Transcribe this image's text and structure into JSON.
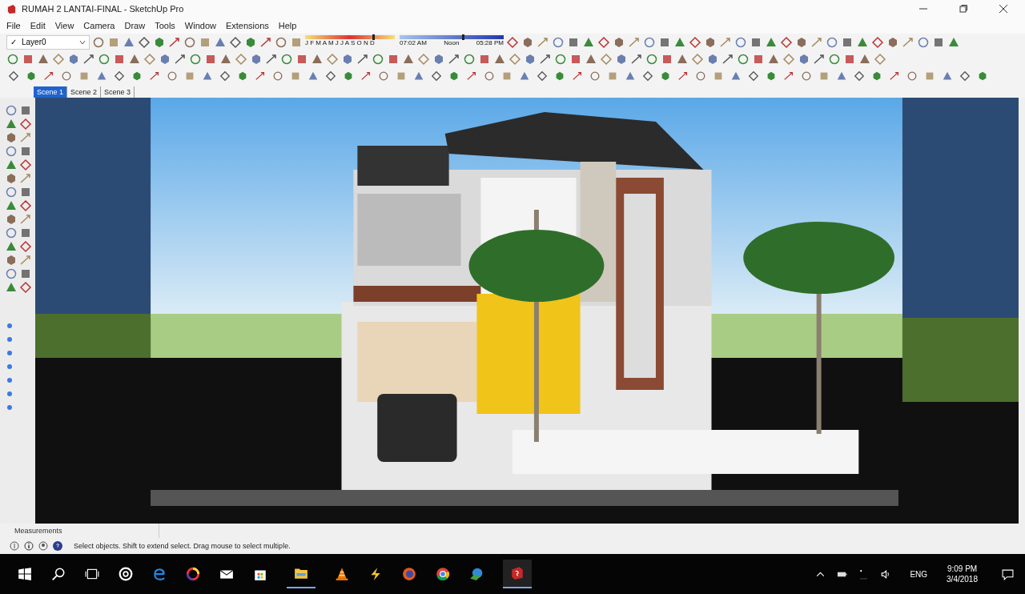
{
  "window": {
    "title": "RUMAH 2 LANTAI-FINAL - SketchUp Pro"
  },
  "menu": [
    "File",
    "Edit",
    "View",
    "Camera",
    "Draw",
    "Tools",
    "Window",
    "Extensions",
    "Help"
  ],
  "layer": {
    "check": "✓",
    "name": "Layer0"
  },
  "shadow": {
    "month_slider": {
      "months": "J F M A M J J A S O N D",
      "level": 0.75
    },
    "time_slider": {
      "times": [
        "07:02 AM",
        "Noon",
        "05:28 PM"
      ],
      "level": 0.6
    }
  },
  "scenes": [
    {
      "label": "Scene 1",
      "selected": true
    },
    {
      "label": "Scene 2",
      "selected": false
    },
    {
      "label": "Scene 3",
      "selected": false
    }
  ],
  "measurements": {
    "label": "Measurements"
  },
  "status_bar": {
    "hint": "Select objects. Shift to extend select. Drag mouse to select multiple."
  },
  "taskbar": {
    "language": "ENG",
    "time": "9:09 PM",
    "date": "3/4/2018"
  }
}
